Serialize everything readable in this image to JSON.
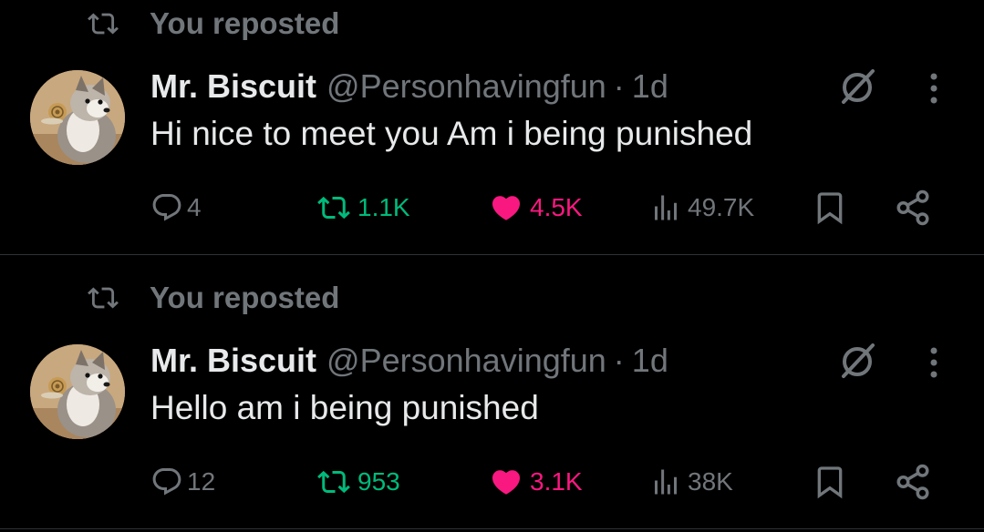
{
  "posts": [
    {
      "repost_label": "You reposted",
      "author_name": "Mr. Biscuit",
      "handle": "@Personhavingfun",
      "separator": "·",
      "time": "1d",
      "text": "Hi nice to meet you Am i being punished",
      "replies": "4",
      "reposts": "1.1K",
      "likes": "4.5K",
      "views": "49.7K",
      "reposted_by_me": true,
      "liked_by_me": true
    },
    {
      "repost_label": "You reposted",
      "author_name": "Mr. Biscuit",
      "handle": "@Personhavingfun",
      "separator": "·",
      "time": "1d",
      "text": "Hello am i being punished",
      "replies": "12",
      "reposts": "953",
      "likes": "3.1K",
      "views": "38K",
      "reposted_by_me": true,
      "liked_by_me": true
    }
  ],
  "icons": {
    "repost_context": "repost-icon",
    "avatar": "avatar",
    "grok": "grok-icon",
    "more": "more-icon",
    "reply": "reply-icon",
    "repost": "repost-icon",
    "like": "heart-icon",
    "views": "views-icon",
    "bookmark": "bookmark-icon",
    "share": "share-icon"
  },
  "colors": {
    "background": "#000000",
    "divider": "#2f3336",
    "primary_text": "#e7e9ea",
    "secondary_text": "#71767b",
    "repost_active": "#00ba7c",
    "like_active": "#f91880"
  }
}
